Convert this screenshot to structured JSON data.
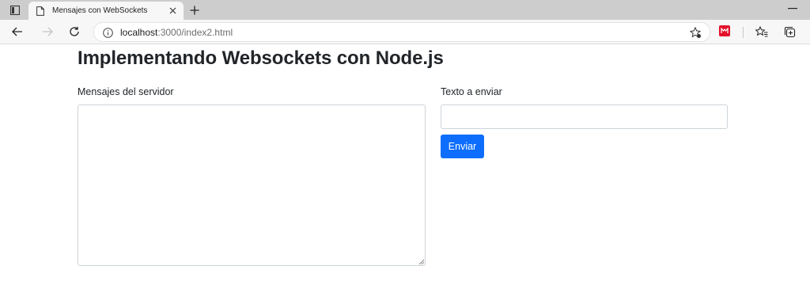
{
  "browser": {
    "tab": {
      "title": "Mensajes con WebSockets",
      "icon": "page-icon",
      "close_icon": "close-icon"
    },
    "new_tab_icon": "plus-icon",
    "address": {
      "host": "localhost",
      "path": ":3000/index2.html"
    },
    "toolbar_icons": [
      "back-arrow-icon",
      "forward-arrow-icon",
      "refresh-icon",
      "info-icon",
      "favorite-add-icon",
      "extension-icon",
      "favorites-icon",
      "collections-icon"
    ]
  },
  "page": {
    "title": "Implementando Websockets con Node.js",
    "messages_label": "Mensajes del servidor",
    "messages_value": "",
    "send_label": "Texto a enviar",
    "send_value": "",
    "send_button": "Enviar"
  },
  "colors": {
    "primary_button": "#0d6efd",
    "tabstrip": "#cdcdcd",
    "toolbar": "#f7f7f7",
    "extension": "#e3102a"
  }
}
